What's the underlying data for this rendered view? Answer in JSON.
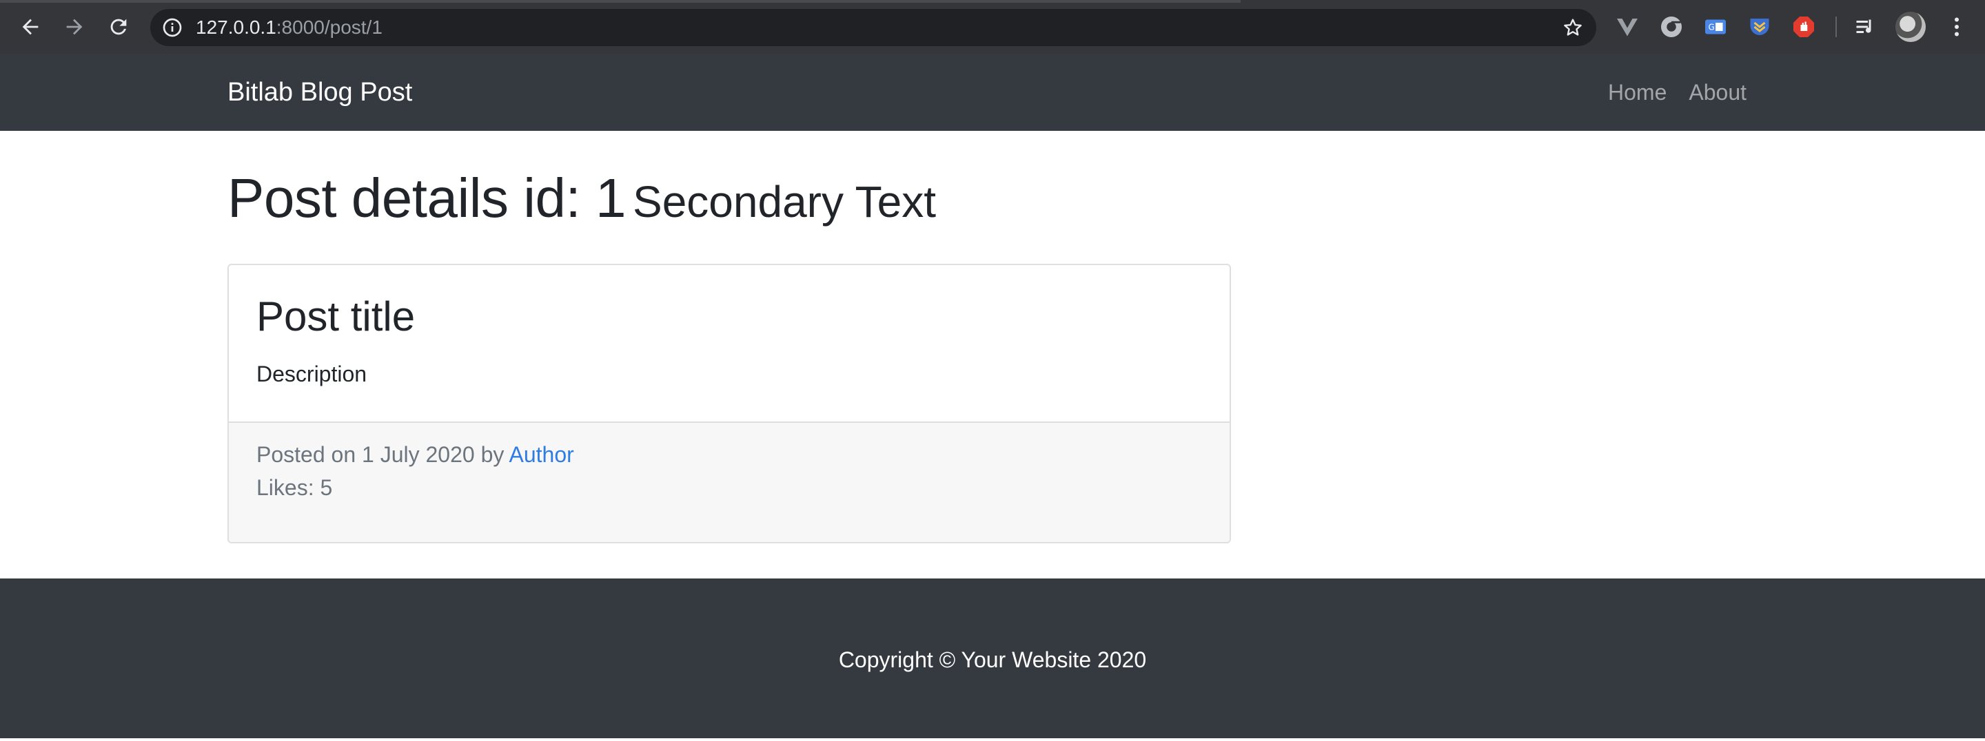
{
  "browser": {
    "url_host": "127.0.0.1",
    "url_path": ":8000/post/1",
    "icons": [
      "back-icon",
      "forward-icon",
      "reload-icon",
      "site-info-icon",
      "bookmark-star-icon",
      "vue-devtools-icon",
      "chrome-extension-icon",
      "translate-extension-icon",
      "pocket-extension-icon",
      "adblock-icon",
      "reading-list-icon",
      "profile-avatar",
      "kebab-menu-icon"
    ]
  },
  "navbar": {
    "brand": "Bitlab Blog Post",
    "links": [
      {
        "label": "Home"
      },
      {
        "label": "About"
      }
    ]
  },
  "page": {
    "heading_primary": "Post details id: 1",
    "heading_secondary": "Secondary Text"
  },
  "post": {
    "title": "Post title",
    "description": "Description",
    "posted_prefix": "Posted on 1 July 2020 by ",
    "author": "Author",
    "likes_text": "Likes: 5"
  },
  "footer": {
    "copyright": "Copyright © Your Website 2020"
  },
  "colors": {
    "navbar_bg": "#343a40",
    "link_blue": "#2f7ce3",
    "muted_text": "#6c757d",
    "card_footer_bg": "#f7f7f7"
  }
}
